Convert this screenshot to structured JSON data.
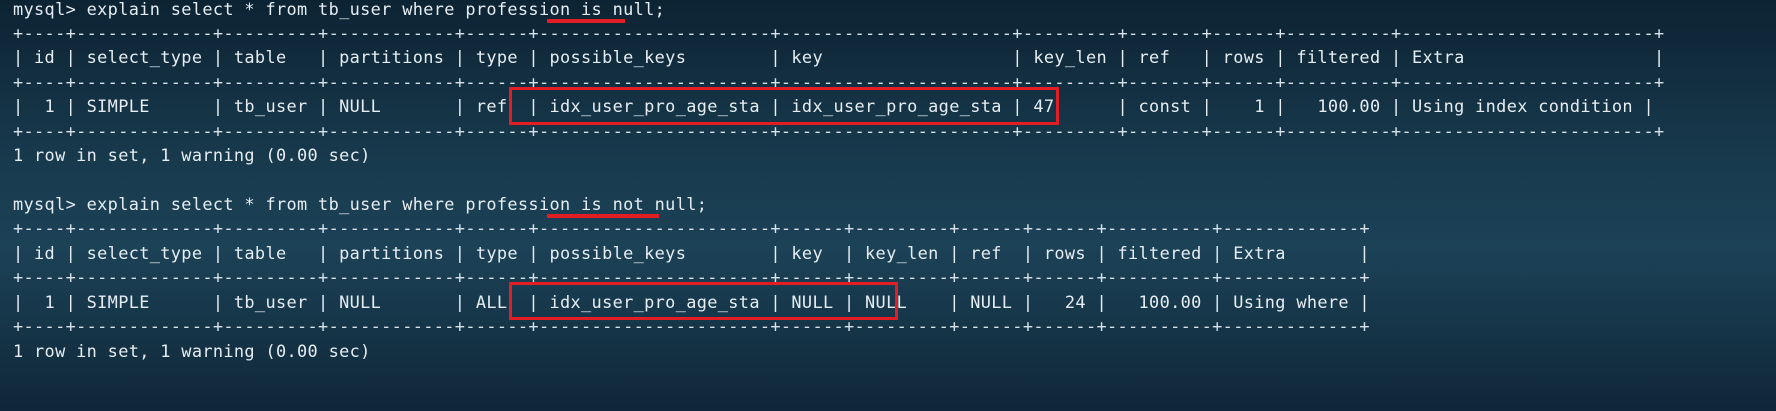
{
  "terminal": {
    "blocks": [
      {
        "command": "mysql> explain select * from tb_user where profession is null;",
        "separator": "+----+-------------+---------+------------+------+----------------------+----------------------+---------+-------+------+----------+------------------------+",
        "header": "| id | select_type | table   | partitions | type | possible_keys        | key                  | key_len | ref   | rows | filtered | Extra                  |",
        "row": "|  1 | SIMPLE      | tb_user | NULL       | ref  | idx_user_pro_age_sta | idx_user_pro_age_sta | 47      | const |    1 |   100.00 | Using index condition |",
        "footer": "1 row in set, 1 warning (0.00 sec)",
        "highlight_text": "is null"
      },
      {
        "command": "mysql> explain select * from tb_user where profession is not null;",
        "separator": "+----+-------------+---------+------------+------+----------------------+------+---------+------+------+----------+-------------+",
        "header": "| id | select_type | table   | partitions | type | possible_keys        | key  | key_len | ref  | rows | filtered | Extra       |",
        "row": "|  1 | SIMPLE      | tb_user | NULL       | ALL  | idx_user_pro_age_sta | NULL | NULL    | NULL |   24 |   100.00 | Using where |",
        "footer": "1 row in set, 1 warning (0.00 sec)",
        "highlight_text": "is not null"
      }
    ],
    "accent_color": "#e21d24",
    "background_color": "#17384b",
    "text_color": "#e6edf2"
  }
}
